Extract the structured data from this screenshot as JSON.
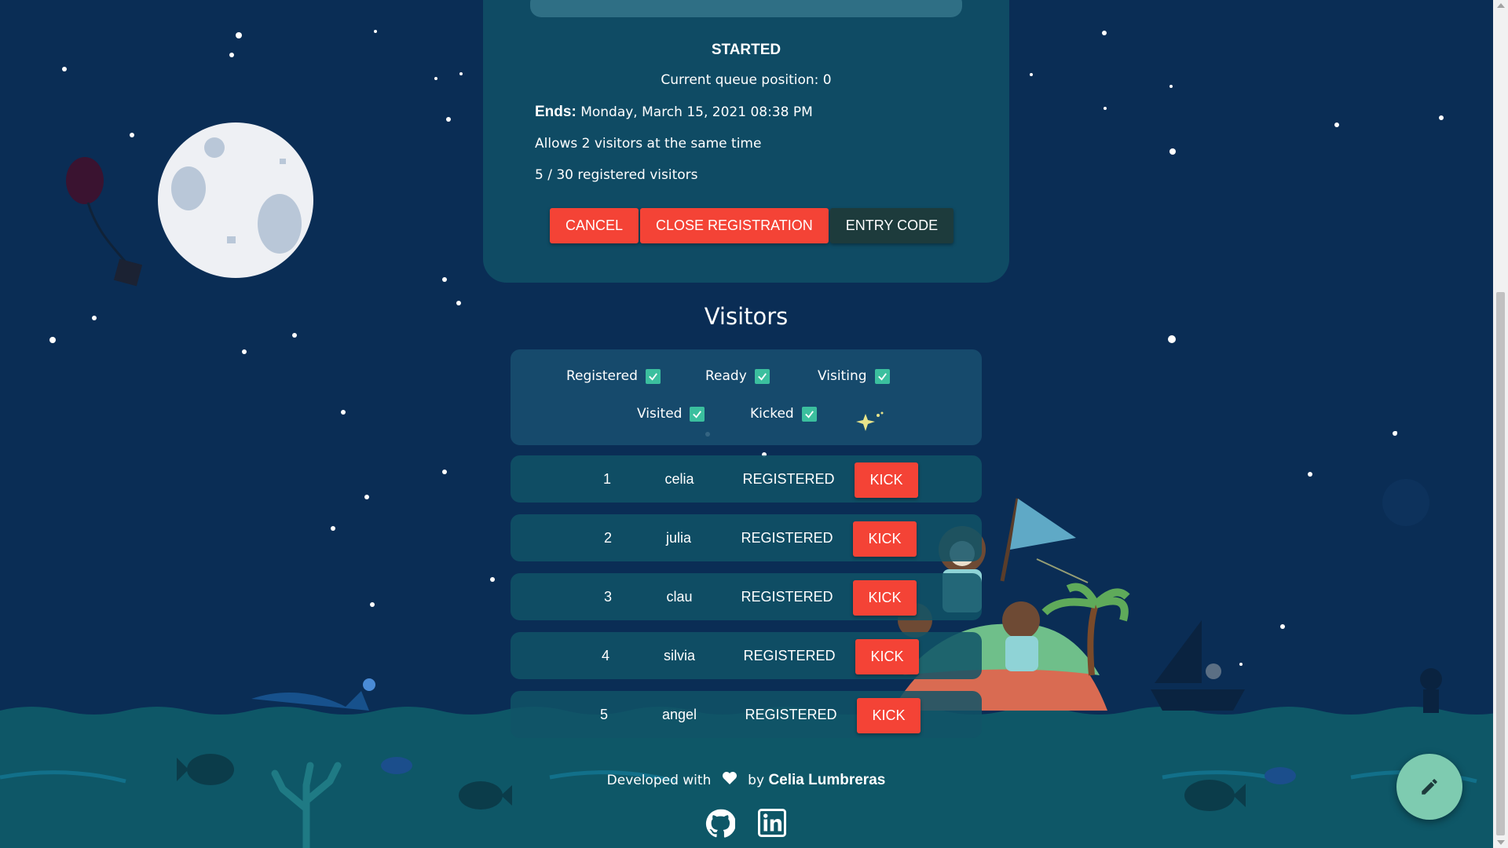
{
  "session": {
    "status": "STARTED",
    "queue_position": "Current queue position: 0",
    "ends_label": "Ends:",
    "ends_value": "Monday, March 15, 2021 08:38 PM",
    "allows": "Allows 2 visitors at the same time",
    "registered_count": "5 / 30 registered visitors",
    "buttons": {
      "cancel": "CANCEL",
      "close_registration": "CLOSE REGISTRATION",
      "entry_code": "ENTRY CODE"
    }
  },
  "visitors": {
    "title": "Visitors",
    "filters": [
      {
        "label": "Registered",
        "checked": true
      },
      {
        "label": "Ready",
        "checked": true
      },
      {
        "label": "Visiting",
        "checked": true
      },
      {
        "label": "Visited",
        "checked": true
      },
      {
        "label": "Kicked",
        "checked": true
      }
    ],
    "rows": [
      {
        "num": "1",
        "name": "celia",
        "state": "REGISTERED",
        "action": "KICK"
      },
      {
        "num": "2",
        "name": "julia",
        "state": "REGISTERED",
        "action": "KICK"
      },
      {
        "num": "3",
        "name": "clau",
        "state": "REGISTERED",
        "action": "KICK"
      },
      {
        "num": "4",
        "name": "silvia",
        "state": "REGISTERED",
        "action": "KICK"
      },
      {
        "num": "5",
        "name": "angel",
        "state": "REGISTERED",
        "action": "KICK"
      }
    ]
  },
  "footer": {
    "developed_with": "Developed with",
    "by": "by",
    "author": "Celia Lumbreras",
    "icons": [
      "heart-icon",
      "github-icon",
      "linkedin-icon"
    ]
  },
  "fab": {
    "icon": "pencil-icon"
  },
  "colors": {
    "sky": "#0a2d55",
    "sea": "#0f5a6a",
    "card": "#0f4b64",
    "red_button": "#f44336",
    "dark_button": "#1d3b3c",
    "check": "#3bbf9e",
    "fab": "#7ecbb0"
  }
}
